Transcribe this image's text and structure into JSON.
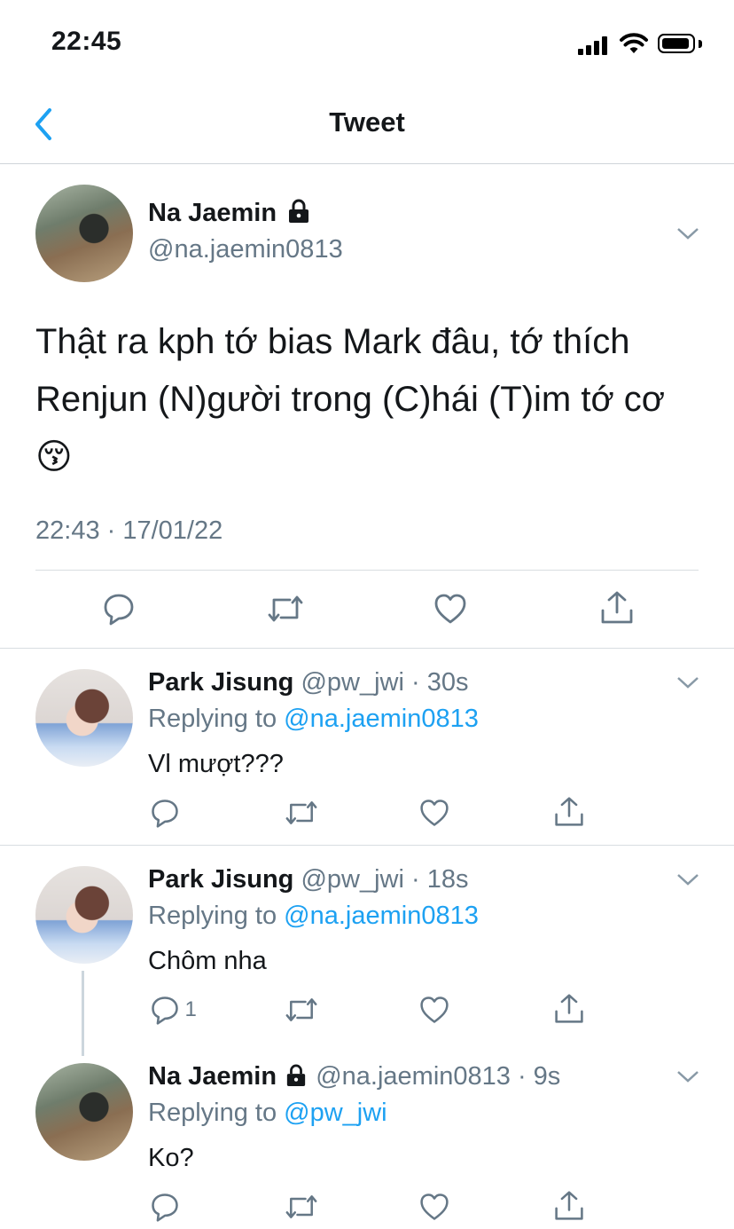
{
  "status_bar": {
    "time": "22:45"
  },
  "nav": {
    "title": "Tweet",
    "back_icon": "chevron-left-icon"
  },
  "main_tweet": {
    "display_name": "Na Jaemin",
    "handle": "@na.jaemin0813",
    "text": "Thật ra kph tớ bias Mark đâu, tớ thích Renjun (N)gười trong (C)hái (T)im tớ cơ 😚",
    "timestamp": "22:43 · 17/01/22"
  },
  "replies": [
    {
      "display_name": "Park Jisung",
      "handle_time": "@pw_jwi · 30s",
      "replying_label": "Replying to",
      "replying_to": "@na.jaemin0813",
      "text": "Vl mượt???"
    },
    {
      "display_name": "Park Jisung",
      "handle_time": "@pw_jwi · 18s",
      "replying_label": "Replying to",
      "replying_to": "@na.jaemin0813",
      "text": "Chôm nha",
      "reply_count": "1"
    },
    {
      "display_name": "Na Jaemin",
      "handle_time": "@na.jaemin0813 · 9s",
      "replying_label": "Replying to",
      "replying_to": "@pw_jwi",
      "text": "Ko?"
    }
  ],
  "colors": {
    "link": "#1da1f2",
    "secondary_text": "#657786",
    "primary_text": "#14171a",
    "divider": "#d8dde1"
  }
}
